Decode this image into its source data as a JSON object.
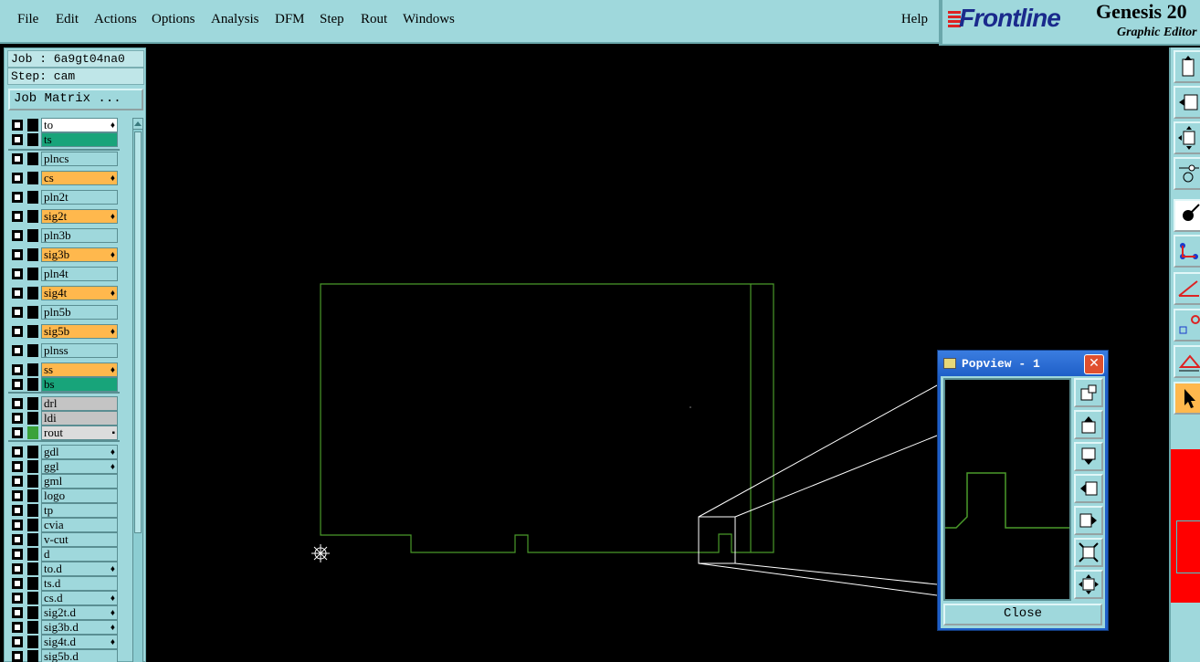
{
  "menu": {
    "items": [
      "File",
      "Edit",
      "Actions",
      "Options",
      "Analysis",
      "DFM",
      "Step",
      "Rout",
      "Windows"
    ],
    "help": "Help"
  },
  "brand": {
    "logo": "Frontline",
    "product": "Genesis 20",
    "subtitle": "Graphic Editor"
  },
  "job": {
    "job_label": "Job : 6a9gt04na0",
    "step_label": "Step: cam",
    "matrix_button": "Job Matrix ..."
  },
  "layers": [
    {
      "name": "to",
      "bg": "white",
      "flag": "♦"
    },
    {
      "name": "ts",
      "bg": "teal",
      "flag": ""
    },
    {
      "name": "plncs",
      "bg": "cyan",
      "flag": ""
    },
    {
      "name": "cs",
      "bg": "orange",
      "flag": "♦"
    },
    {
      "name": "pln2t",
      "bg": "cyan",
      "flag": ""
    },
    {
      "name": "sig2t",
      "bg": "orange",
      "flag": "♦"
    },
    {
      "name": "pln3b",
      "bg": "cyan",
      "flag": ""
    },
    {
      "name": "sig3b",
      "bg": "orange",
      "flag": "♦"
    },
    {
      "name": "pln4t",
      "bg": "cyan",
      "flag": ""
    },
    {
      "name": "sig4t",
      "bg": "orange",
      "flag": "♦"
    },
    {
      "name": "pln5b",
      "bg": "cyan",
      "flag": ""
    },
    {
      "name": "sig5b",
      "bg": "orange",
      "flag": "♦"
    },
    {
      "name": "plnss",
      "bg": "cyan",
      "flag": ""
    },
    {
      "name": "ss",
      "bg": "orange",
      "flag": "♦"
    },
    {
      "name": "bs",
      "bg": "teal",
      "flag": ""
    },
    {
      "name": "drl",
      "bg": "gray",
      "flag": ""
    },
    {
      "name": "ldi",
      "bg": "gray",
      "flag": ""
    },
    {
      "name": "rout",
      "bg": "lgray",
      "flag": "▪"
    },
    {
      "name": "gdl",
      "bg": "cyan",
      "flag": "♦"
    },
    {
      "name": "ggl",
      "bg": "cyan",
      "flag": "♦"
    },
    {
      "name": "gml",
      "bg": "cyan",
      "flag": ""
    },
    {
      "name": "logo",
      "bg": "cyan",
      "flag": ""
    },
    {
      "name": "tp",
      "bg": "cyan",
      "flag": ""
    },
    {
      "name": "cvia",
      "bg": "cyan",
      "flag": ""
    },
    {
      "name": "v-cut",
      "bg": "cyan",
      "flag": ""
    },
    {
      "name": "d",
      "bg": "cyan",
      "flag": ""
    },
    {
      "name": "to.d",
      "bg": "cyan",
      "flag": "♦"
    },
    {
      "name": "ts.d",
      "bg": "cyan",
      "flag": ""
    },
    {
      "name": "cs.d",
      "bg": "cyan",
      "flag": "♦"
    },
    {
      "name": "sig2t.d",
      "bg": "cyan",
      "flag": "♦"
    },
    {
      "name": "sig3b.d",
      "bg": "cyan",
      "flag": "♦"
    },
    {
      "name": "sig4t.d",
      "bg": "cyan",
      "flag": "♦"
    },
    {
      "name": "sig5b.d",
      "bg": "cyan",
      "flag": ""
    }
  ],
  "popview": {
    "title": "Popview - 1",
    "close_label": "Close"
  },
  "colors": {
    "profile_line": "#4a9a2a",
    "zoom_lines": "#ffffff",
    "panel_bg": "#9fd8dc"
  }
}
